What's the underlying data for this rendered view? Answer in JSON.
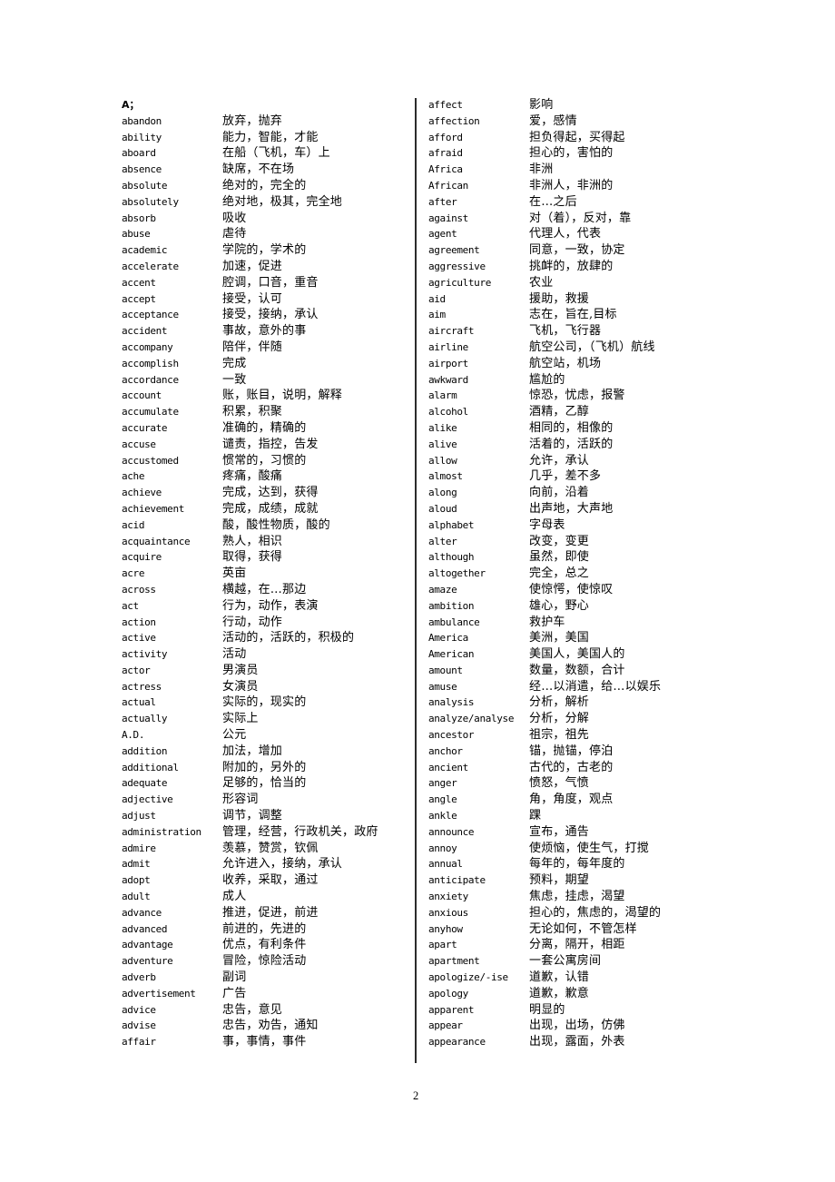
{
  "document": {
    "page_number": "2",
    "section_heading": "A；"
  },
  "columns": {
    "left": [
      {
        "term": "abandon",
        "gloss": "放弃，抛弃"
      },
      {
        "term": "ability",
        "gloss": "能力，智能，才能"
      },
      {
        "term": "aboard",
        "gloss": "在船（飞机，车）上"
      },
      {
        "term": "absence",
        "gloss": "缺席，不在场"
      },
      {
        "term": "absolute",
        "gloss": "绝对的，完全的"
      },
      {
        "term": "absolutely",
        "gloss": "绝对地，极其，完全地"
      },
      {
        "term": "absorb",
        "gloss": "吸收"
      },
      {
        "term": "abuse",
        "gloss": "虐待"
      },
      {
        "term": "academic",
        "gloss": "学院的，学术的"
      },
      {
        "term": "accelerate",
        "gloss": "加速，促进"
      },
      {
        "term": "accent",
        "gloss": "腔调，口音，重音"
      },
      {
        "term": "accept",
        "gloss": "接受，认可"
      },
      {
        "term": "acceptance",
        "gloss": "接受，接纳，承认"
      },
      {
        "term": "accident",
        "gloss": "事故，意外的事"
      },
      {
        "term": "accompany",
        "gloss": "陪伴，伴随"
      },
      {
        "term": "accomplish",
        "gloss": "完成"
      },
      {
        "term": "accordance",
        "gloss": "一致"
      },
      {
        "term": "account",
        "gloss": "账，账目，说明，解释"
      },
      {
        "term": "accumulate",
        "gloss": "积累，积聚"
      },
      {
        "term": "accurate",
        "gloss": "准确的，精确的"
      },
      {
        "term": "accuse",
        "gloss": "谴责，指控，告发"
      },
      {
        "term": "accustomed",
        "gloss": "惯常的，习惯的"
      },
      {
        "term": "ache",
        "gloss": "疼痛，酸痛"
      },
      {
        "term": "achieve",
        "gloss": "完成，达到，获得"
      },
      {
        "term": "achievement",
        "gloss": "完成，成绩，成就"
      },
      {
        "term": "acid",
        "gloss": "酸，酸性物质，酸的"
      },
      {
        "term": "acquaintance",
        "gloss": "熟人，相识"
      },
      {
        "term": "acquire",
        "gloss": "取得，获得"
      },
      {
        "term": "acre",
        "gloss": "英亩"
      },
      {
        "term": "across",
        "gloss": "横越，在…那边"
      },
      {
        "term": "act",
        "gloss": "行为，动作，表演"
      },
      {
        "term": "action",
        "gloss": "行动，动作"
      },
      {
        "term": "active",
        "gloss": "活动的，活跃的，积极的"
      },
      {
        "term": "activity",
        "gloss": "活动"
      },
      {
        "term": "actor",
        "gloss": "男演员"
      },
      {
        "term": "actress",
        "gloss": "女演员"
      },
      {
        "term": "actual",
        "gloss": "实际的，现实的"
      },
      {
        "term": "actually",
        "gloss": "实际上"
      },
      {
        "term": "A.D.",
        "gloss": "公元"
      },
      {
        "term": "addition",
        "gloss": "加法，增加"
      },
      {
        "term": "additional",
        "gloss": "附加的，另外的"
      },
      {
        "term": "adequate",
        "gloss": "足够的，恰当的"
      },
      {
        "term": "adjective",
        "gloss": "形容词"
      },
      {
        "term": "adjust",
        "gloss": "调节，调整"
      },
      {
        "term": "administration",
        "gloss": "管理，经营，行政机关，政府"
      },
      {
        "term": "admire",
        "gloss": "羡慕，赞赏，钦佩"
      },
      {
        "term": "admit",
        "gloss": "允许进入，接纳，承认"
      },
      {
        "term": "adopt",
        "gloss": "收养，采取，通过"
      },
      {
        "term": "adult",
        "gloss": "成人"
      },
      {
        "term": "advance",
        "gloss": "推进，促进，前进"
      },
      {
        "term": "advanced",
        "gloss": "前进的，先进的"
      },
      {
        "term": "advantage",
        "gloss": "优点，有利条件"
      },
      {
        "term": "adventure",
        "gloss": "冒险，惊险活动"
      },
      {
        "term": "adverb",
        "gloss": "副词"
      },
      {
        "term": "advertisement",
        "gloss": "广告"
      },
      {
        "term": "advice",
        "gloss": "忠告，意见"
      },
      {
        "term": "advise",
        "gloss": "忠告，劝告，通知"
      },
      {
        "term": "affair",
        "gloss": "事，事情，事件"
      }
    ],
    "right": [
      {
        "term": "affect",
        "gloss": "影响"
      },
      {
        "term": "affection",
        "gloss": "爱，感情"
      },
      {
        "term": "afford",
        "gloss": "担负得起，买得起"
      },
      {
        "term": "afraid",
        "gloss": "担心的，害怕的"
      },
      {
        "term": "Africa",
        "gloss": "非洲"
      },
      {
        "term": "African",
        "gloss": "非洲人，非洲的"
      },
      {
        "term": "after",
        "gloss": "在…之后"
      },
      {
        "term": "against",
        "gloss": "对（着），反对，靠"
      },
      {
        "term": "agent",
        "gloss": "代理人，代表"
      },
      {
        "term": "agreement",
        "gloss": "同意，一致，协定"
      },
      {
        "term": "aggressive",
        "gloss": "挑衅的，放肆的"
      },
      {
        "term": "agriculture",
        "gloss": "农业"
      },
      {
        "term": "aid",
        "gloss": "援助，救援"
      },
      {
        "term": "aim",
        "gloss": "志在，旨在,目标"
      },
      {
        "term": "aircraft",
        "gloss": "飞机，飞行器"
      },
      {
        "term": "airline",
        "gloss": "航空公司，（飞机）航线"
      },
      {
        "term": "airport",
        "gloss": "航空站，机场"
      },
      {
        "term": "awkward",
        "gloss": "尴尬的"
      },
      {
        "term": "alarm",
        "gloss": "惊恐，忧虑，报警"
      },
      {
        "term": "alcohol",
        "gloss": "酒精，乙醇"
      },
      {
        "term": "alike",
        "gloss": "相同的，相像的"
      },
      {
        "term": "alive",
        "gloss": "活着的，活跃的"
      },
      {
        "term": "allow",
        "gloss": "允许，承认"
      },
      {
        "term": "almost",
        "gloss": "几乎，差不多"
      },
      {
        "term": "along",
        "gloss": "向前，沿着"
      },
      {
        "term": "aloud",
        "gloss": "出声地，大声地"
      },
      {
        "term": "alphabet",
        "gloss": "字母表"
      },
      {
        "term": "alter",
        "gloss": "改变，变更"
      },
      {
        "term": "although",
        "gloss": "虽然，即使"
      },
      {
        "term": "altogether",
        "gloss": "完全，总之"
      },
      {
        "term": "amaze",
        "gloss": "使惊愕，使惊叹"
      },
      {
        "term": "ambition",
        "gloss": "雄心，野心"
      },
      {
        "term": "ambulance",
        "gloss": "救护车"
      },
      {
        "term": "America",
        "gloss": "美洲，美国"
      },
      {
        "term": "American",
        "gloss": "美国人，美国人的"
      },
      {
        "term": "amount",
        "gloss": "数量，数额，合计"
      },
      {
        "term": "amuse",
        "gloss": "经…以消遣，给…以娱乐"
      },
      {
        "term": "analysis",
        "gloss": "分析，解析"
      },
      {
        "term": "analyze/analyse",
        "gloss": "分析，分解"
      },
      {
        "term": "ancestor",
        "gloss": "祖宗，祖先"
      },
      {
        "term": "anchor",
        "gloss": "锚，抛锚，停泊"
      },
      {
        "term": "ancient",
        "gloss": "古代的，古老的"
      },
      {
        "term": "anger",
        "gloss": "愤怒，气愤"
      },
      {
        "term": "angle",
        "gloss": "角，角度，观点"
      },
      {
        "term": "ankle",
        "gloss": "踝"
      },
      {
        "term": "announce",
        "gloss": "宣布，通告"
      },
      {
        "term": "annoy",
        "gloss": "使烦恼，使生气，打搅"
      },
      {
        "term": "annual",
        "gloss": "每年的，每年度的"
      },
      {
        "term": "anticipate",
        "gloss": "预料，期望"
      },
      {
        "term": "anxiety",
        "gloss": "焦虑，挂虑，渴望"
      },
      {
        "term": "anxious",
        "gloss": "担心的，焦虑的，渴望的"
      },
      {
        "term": "anyhow",
        "gloss": "无论如何，不管怎样"
      },
      {
        "term": "apart",
        "gloss": "分离，隔开，相距"
      },
      {
        "term": "apartment",
        "gloss": "一套公寓房间"
      },
      {
        "term": "apologize/-ise",
        "gloss": "道歉，认错"
      },
      {
        "term": "apology",
        "gloss": "道歉，歉意"
      },
      {
        "term": "apparent",
        "gloss": "明显的"
      },
      {
        "term": "appear",
        "gloss": "出现，出场，仿佛"
      },
      {
        "term": "appearance",
        "gloss": "出现，露面，外表"
      }
    ]
  }
}
